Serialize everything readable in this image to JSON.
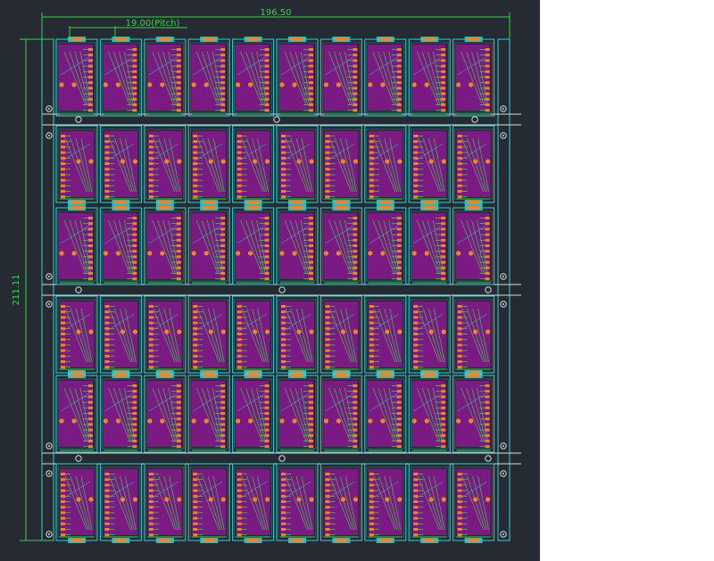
{
  "canvas": {
    "background": "#262b33",
    "outside": "#ffffff"
  },
  "dimensions": {
    "overall_width": "196.50",
    "pitch": "19.00(Pitch)",
    "overall_height": "211.11"
  },
  "panel": {
    "rows": 6,
    "columns": 10,
    "board_color": "#7b1a83",
    "outline_color": "#2bd4d4",
    "pad_color": "#f0842a",
    "trace_color": "#3ad04a",
    "dimension_color": "#3ad04a",
    "rail_color": "#d8d8d8"
  }
}
